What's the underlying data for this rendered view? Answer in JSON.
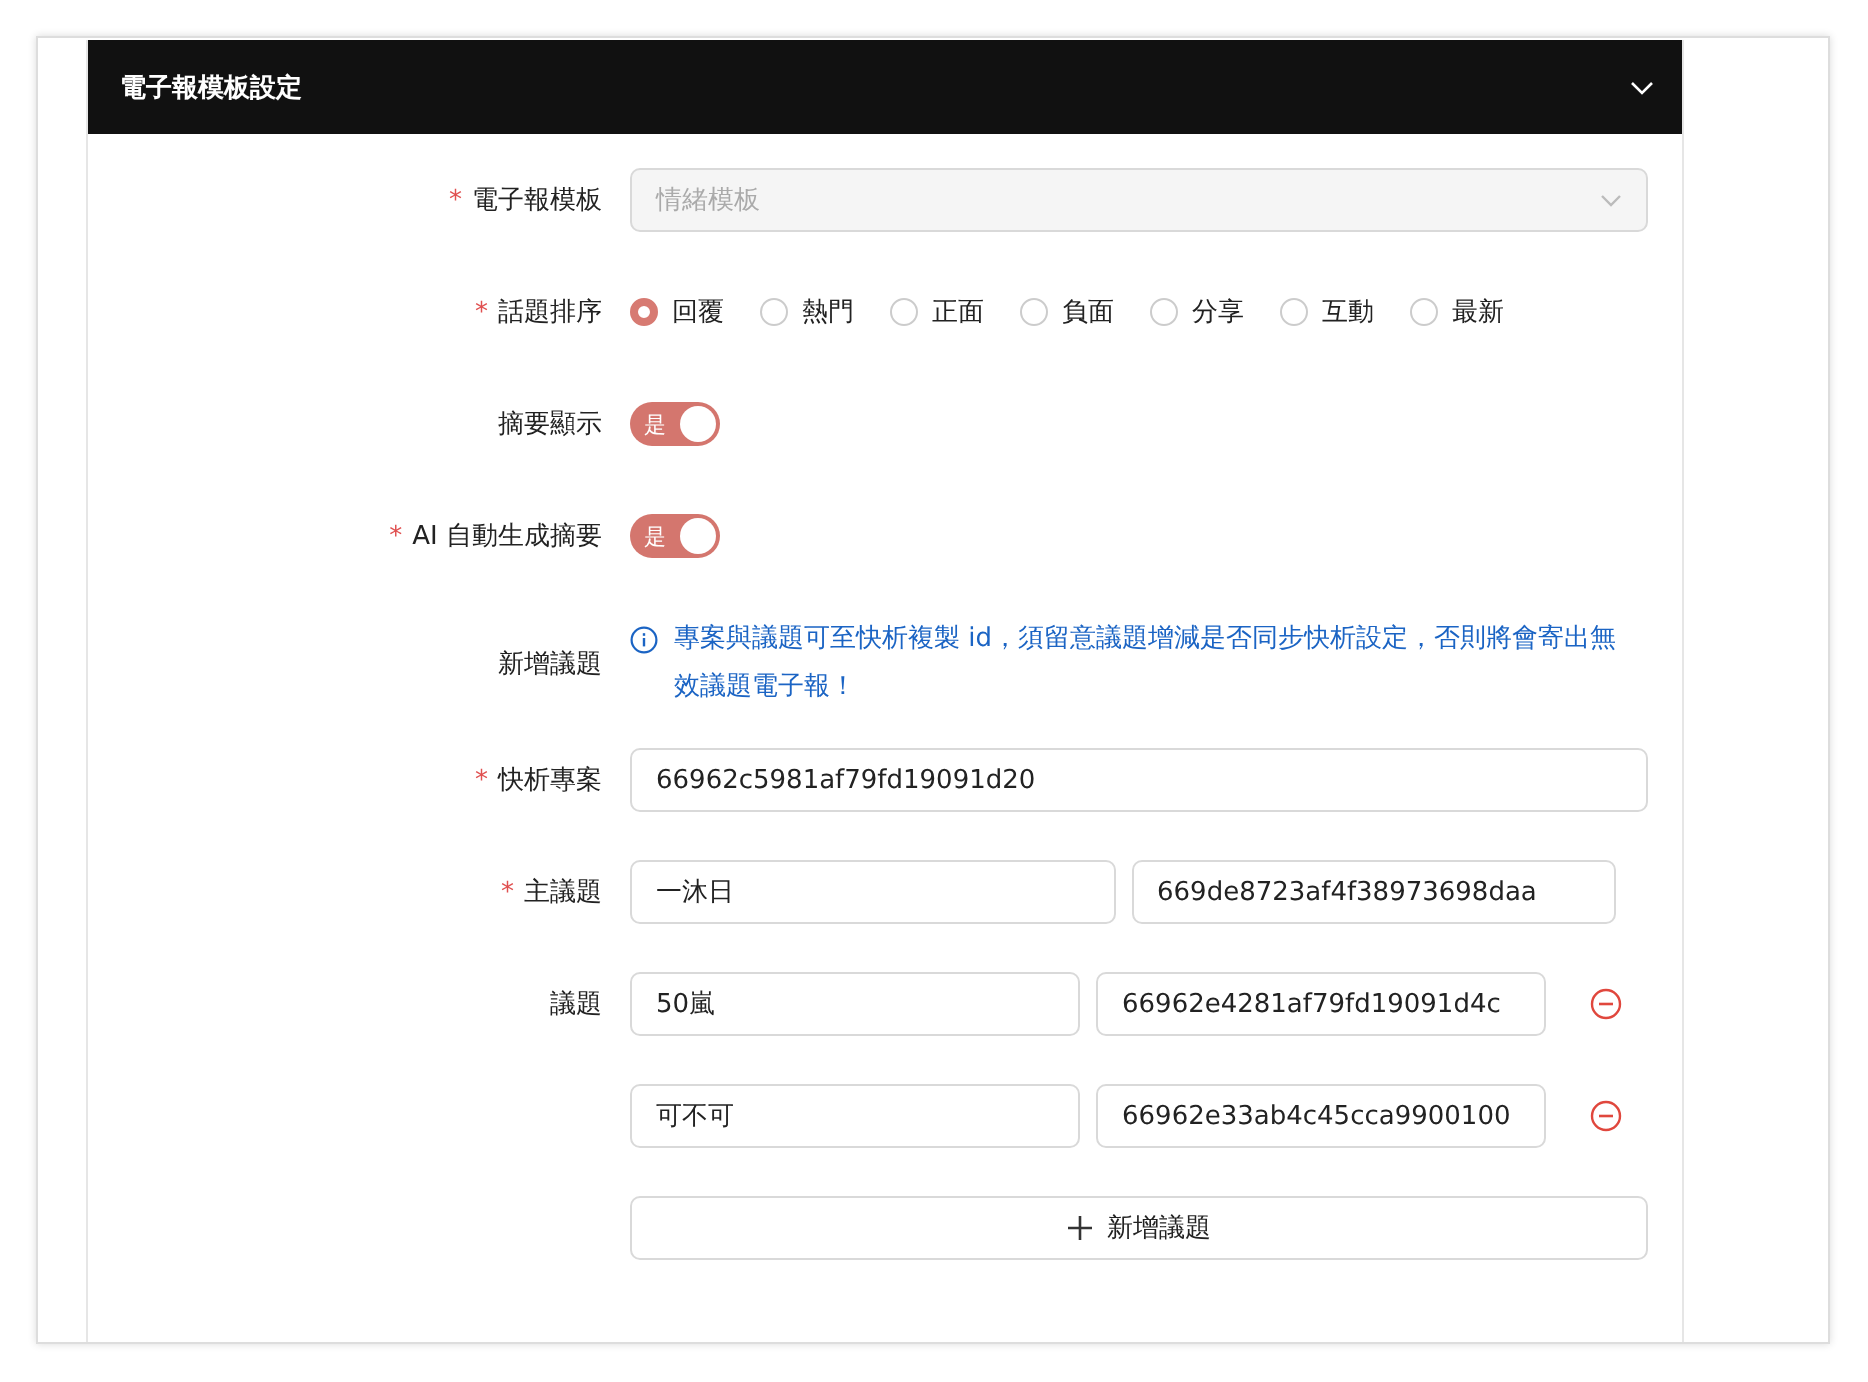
{
  "panel": {
    "title": "電子報模板設定",
    "expanded": true
  },
  "form": [
    {
      "kind": "select",
      "label": "電子報模板",
      "mark": "*",
      "placeholder": "情緒模板",
      "disabled": true
    },
    {
      "kind": "radio",
      "label": "話題排序",
      "mark": "*",
      "options": [
        {
          "label": "回覆",
          "selected": true
        },
        {
          "label": "熱門",
          "selected": false
        },
        {
          "label": "正面",
          "selected": false
        },
        {
          "label": "負面",
          "selected": false
        },
        {
          "label": "分享",
          "selected": false
        },
        {
          "label": "互動",
          "selected": false
        },
        {
          "label": "最新",
          "selected": false
        }
      ]
    },
    {
      "kind": "switch",
      "label": "摘要顯示",
      "on": true,
      "text": "是"
    },
    {
      "kind": "switch",
      "label": "AI 自動生成摘要",
      "mark": "*",
      "on": true,
      "text": "是"
    },
    {
      "kind": "info",
      "label": "新增議題",
      "text": "專案與議題可至快析複製 id，須留意議題增減是否同步快析設定，否則將會寄出無效議題電子報！"
    },
    {
      "kind": "input",
      "label": "快析專案",
      "mark": "*",
      "value": "66962c5981af79fd19091d20"
    },
    {
      "kind": "pair",
      "label": "主議題",
      "mark": "*",
      "name": "一沐日",
      "id": "669de8723af4f38973698daa",
      "removable": false
    },
    {
      "kind": "pair",
      "label": "議題",
      "name": "50嵐",
      "id": "66962e4281af79fd19091d4c",
      "removable": true
    },
    {
      "kind": "pair",
      "name": "可不可",
      "id": "66962e33ab4c45cca9900100",
      "removable": true
    },
    {
      "kind": "add",
      "text": "新增議題"
    }
  ]
}
